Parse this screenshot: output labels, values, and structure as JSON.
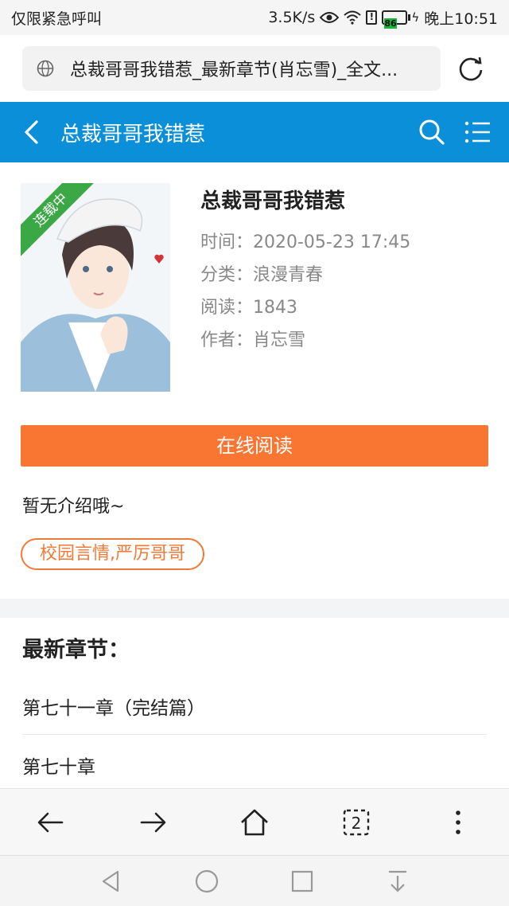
{
  "status_bar": {
    "carrier": "仅限紧急呼叫",
    "speed": "3.5K/s",
    "battery": "86",
    "time": "晚上10:51"
  },
  "browser": {
    "url_title": "总裁哥哥我错惹_最新章节(肖忘雪)_全文..."
  },
  "header": {
    "title": "总裁哥哥我错惹"
  },
  "book": {
    "ribbon": "连载中",
    "title": "总裁哥哥我错惹",
    "time": "时间：2020-05-23 17:45",
    "category": "分类：浪漫青春",
    "reads": "阅读：1843",
    "author": "作者：肖忘雪",
    "read_button": "在线阅读",
    "intro": "暂无介绍哦~",
    "tag": "校园言情,严厉哥哥"
  },
  "chapters": {
    "heading": "最新章节：",
    "items": [
      "第七十一章（完结篇）",
      "第七十章"
    ]
  },
  "colors": {
    "header_bg": "#0b8fd8",
    "accent": "#f97632",
    "ribbon": "#3aa845"
  }
}
